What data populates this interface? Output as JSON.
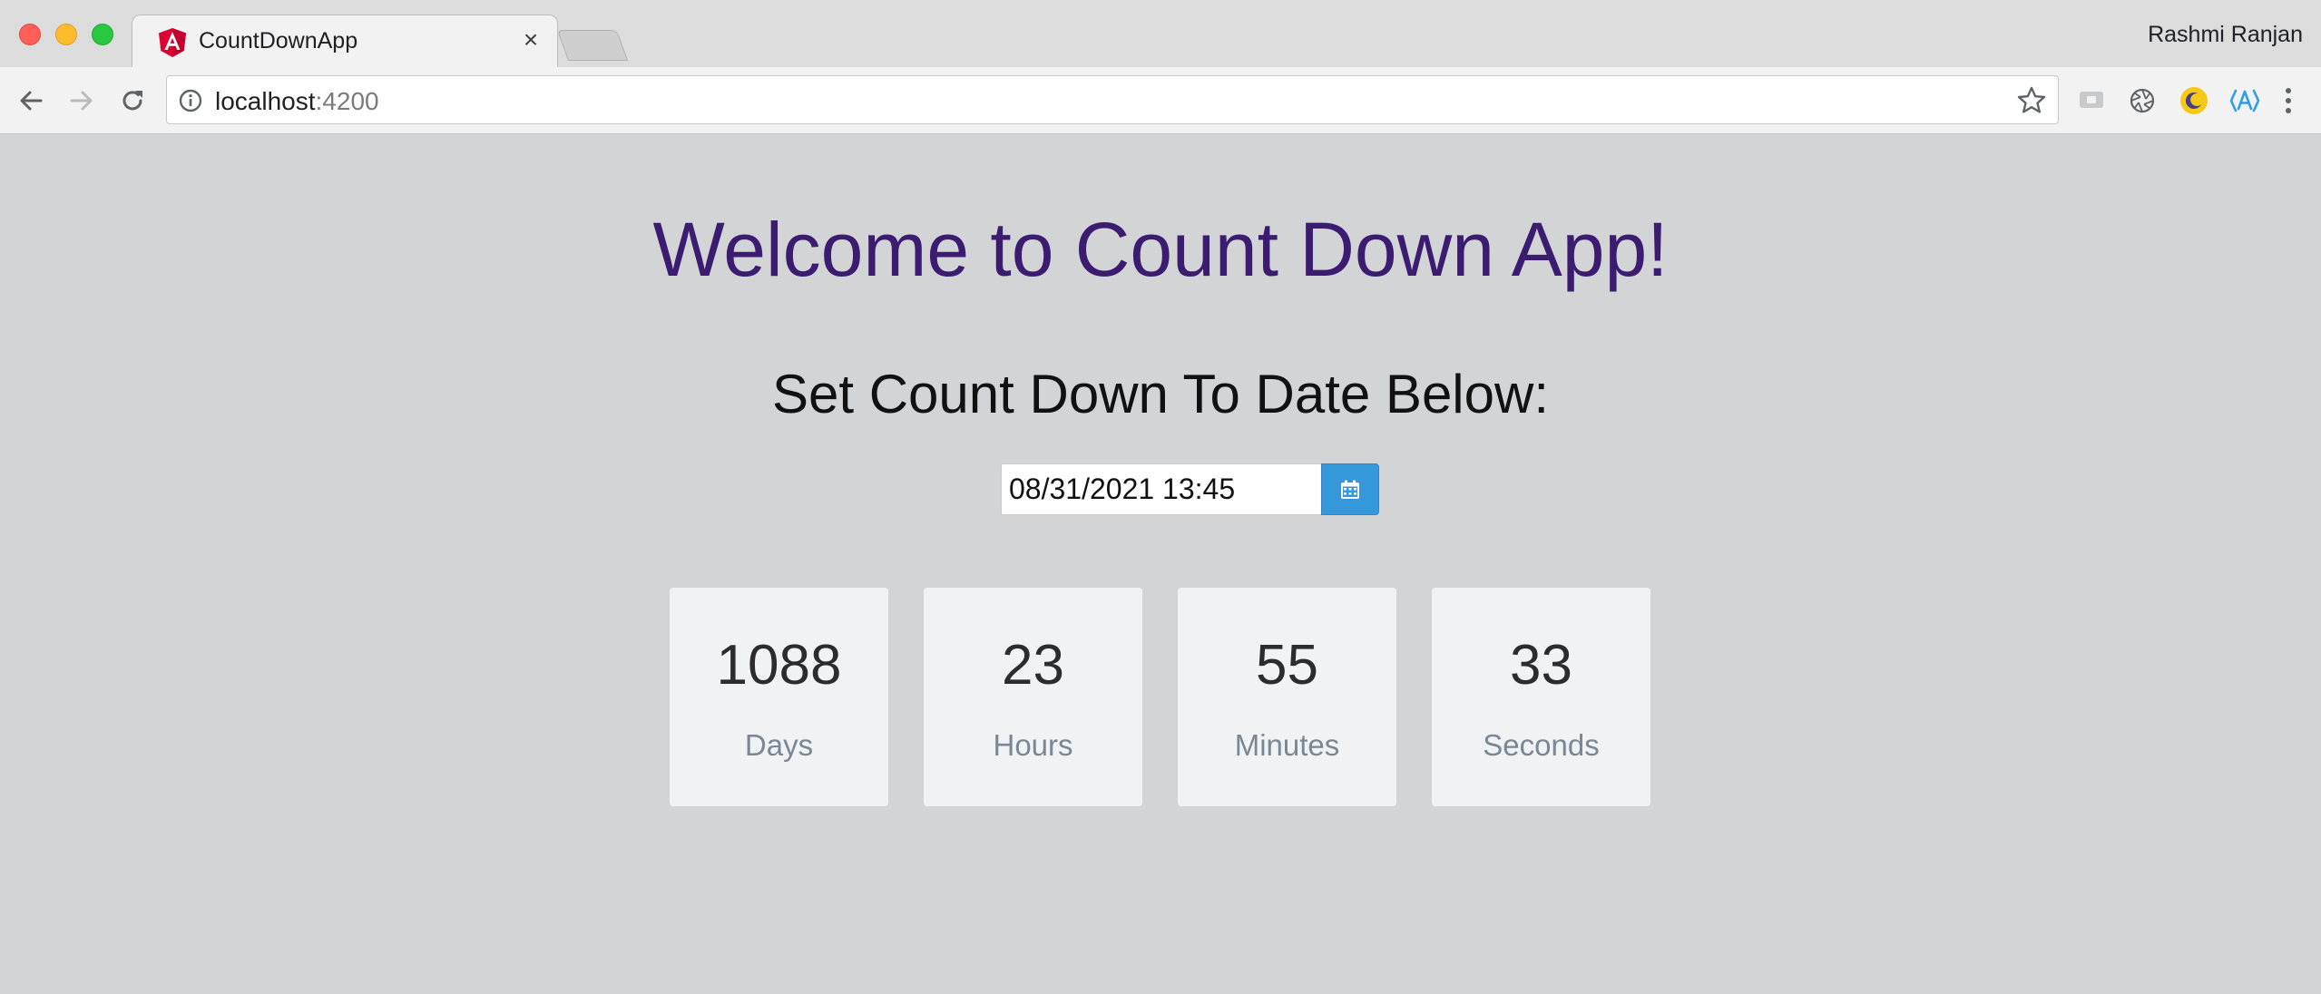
{
  "browser": {
    "tab": {
      "title": "CountDownApp",
      "favicon": "angular-logo-icon"
    },
    "profile_name": "Rashmi Ranjan",
    "address": {
      "host": "localhost",
      "port": ":4200"
    },
    "icons": {
      "back": "arrow-left-icon",
      "forward": "arrow-right-icon",
      "reload": "reload-icon",
      "info": "info-icon",
      "bookmark": "star-icon",
      "menu": "vertical-dots-icon"
    }
  },
  "app": {
    "heading": "Welcome to Count Down App!",
    "subheading": "Set Count Down To Date Below:",
    "date_input": {
      "value": "08/31/2021 13:45"
    },
    "countdown": [
      {
        "value": "1088",
        "label": "Days"
      },
      {
        "value": "23",
        "label": "Hours"
      },
      {
        "value": "55",
        "label": "Minutes"
      },
      {
        "value": "33",
        "label": "Seconds"
      }
    ]
  },
  "colors": {
    "heading": "#3c1c70",
    "page_bg": "#d3d4d6",
    "accent": "#3498db",
    "card_bg": "#f0f2f4"
  }
}
